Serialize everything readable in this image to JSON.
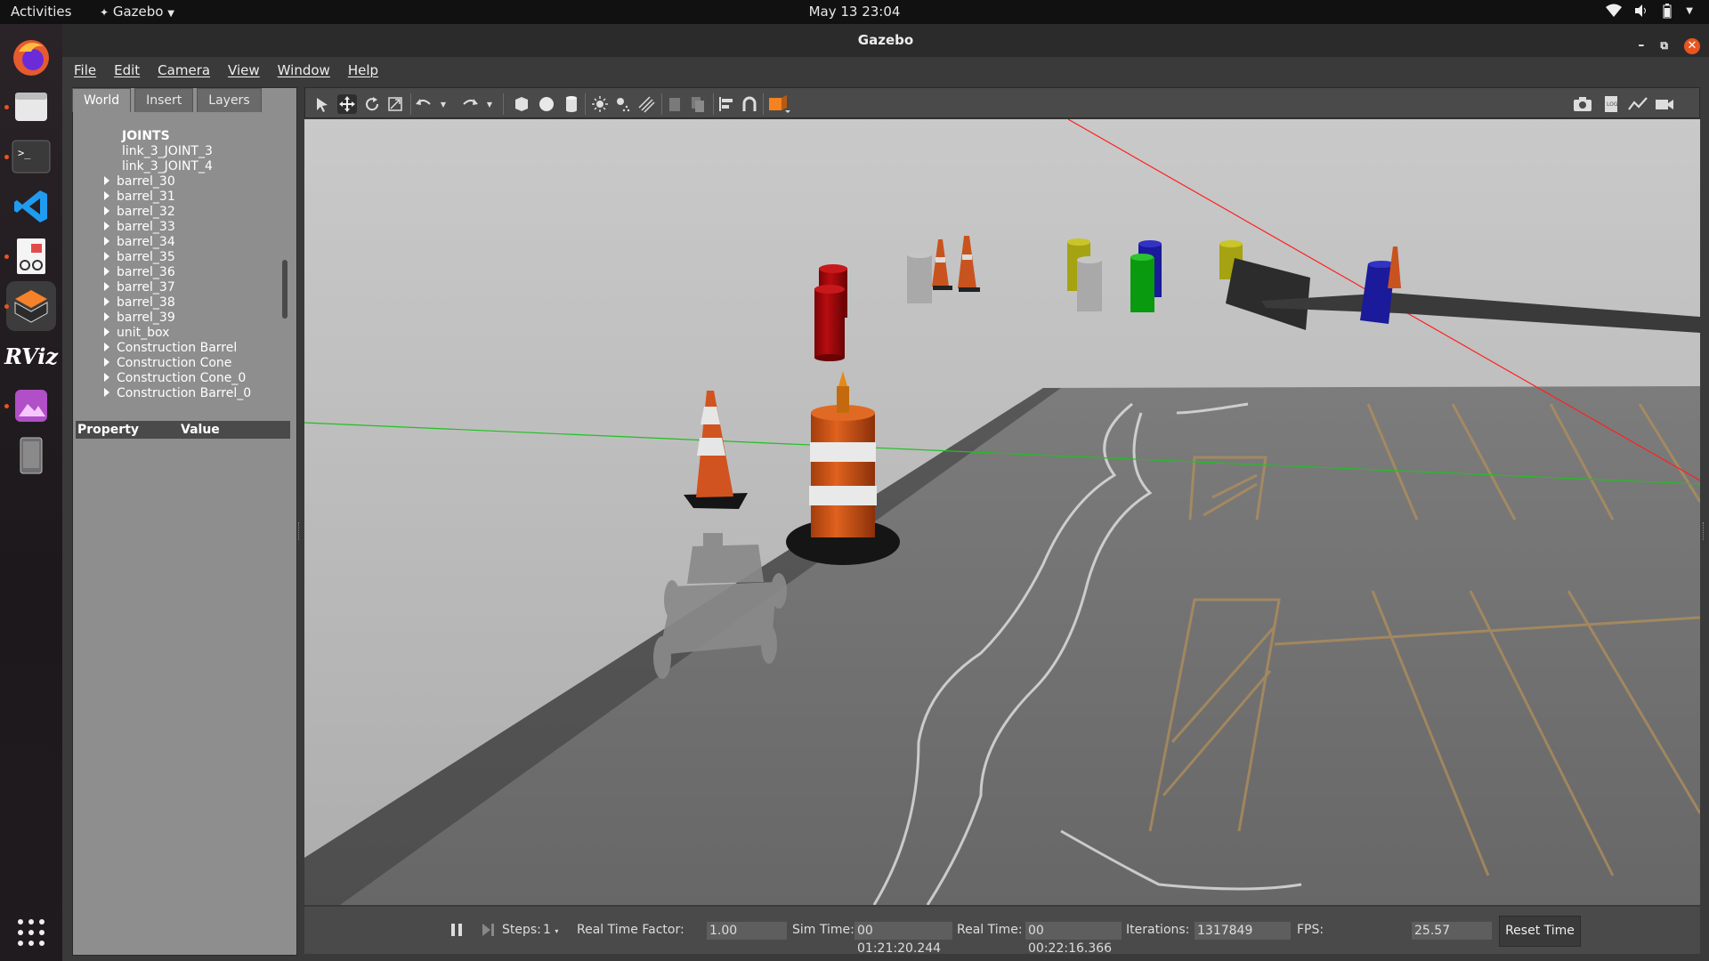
{
  "topbar": {
    "activities": "Activities",
    "app_name": "Gazebo",
    "clock": "May 13  23:04"
  },
  "dock": {
    "apps": [
      "firefox-icon",
      "files-icon",
      "terminal-icon",
      "vscode-icon",
      "document-viewer-icon",
      "gazebo-icon",
      "rviz-icon",
      "image-viewer-icon",
      "removable-drive-icon",
      "show-apps-icon"
    ],
    "rviz_label": "RViz"
  },
  "window": {
    "title": "Gazebo"
  },
  "menu": [
    "File",
    "Edit",
    "Camera",
    "View",
    "Window",
    "Help"
  ],
  "left_tabs": [
    "World",
    "Insert",
    "Layers"
  ],
  "tree": {
    "items": [
      {
        "label": "JOINTS",
        "expandable": false,
        "indent": "group"
      },
      {
        "label": "link_3_JOINT_3",
        "expandable": false,
        "indent": "child"
      },
      {
        "label": "link_3_JOINT_4",
        "expandable": false,
        "indent": "child"
      },
      {
        "label": "barrel_30",
        "expandable": true
      },
      {
        "label": "barrel_31",
        "expandable": true
      },
      {
        "label": "barrel_32",
        "expandable": true
      },
      {
        "label": "barrel_33",
        "expandable": true
      },
      {
        "label": "barrel_34",
        "expandable": true
      },
      {
        "label": "barrel_35",
        "expandable": true
      },
      {
        "label": "barrel_36",
        "expandable": true
      },
      {
        "label": "barrel_37",
        "expandable": true
      },
      {
        "label": "barrel_38",
        "expandable": true
      },
      {
        "label": "barrel_39",
        "expandable": true
      },
      {
        "label": "unit_box",
        "expandable": true
      },
      {
        "label": "Construction Barrel",
        "expandable": true
      },
      {
        "label": "Construction Cone",
        "expandable": true
      },
      {
        "label": "Construction Cone_0",
        "expandable": true
      },
      {
        "label": "Construction Barrel_0",
        "expandable": true
      }
    ]
  },
  "properties": {
    "col_property": "Property",
    "col_value": "Value"
  },
  "status": {
    "steps_label": "Steps:",
    "steps_value": "1",
    "rtf_label": "Real Time Factor:",
    "rtf_value": "1.00",
    "sim_label": "Sim Time:",
    "sim_value": "00 01:21:20.244",
    "real_label": "Real Time:",
    "real_value": "00 00:22:16.366",
    "iter_label": "Iterations:",
    "iter_value": "1317849",
    "fps_label": "FPS:",
    "fps_value": "25.57",
    "reset_label": "Reset Time"
  },
  "colors": {
    "accent": "#e95420",
    "cone_orange": "#d1531f",
    "barrel_red": "#a8090c",
    "x_axis": "#ff2020",
    "y_axis": "#20c020"
  }
}
